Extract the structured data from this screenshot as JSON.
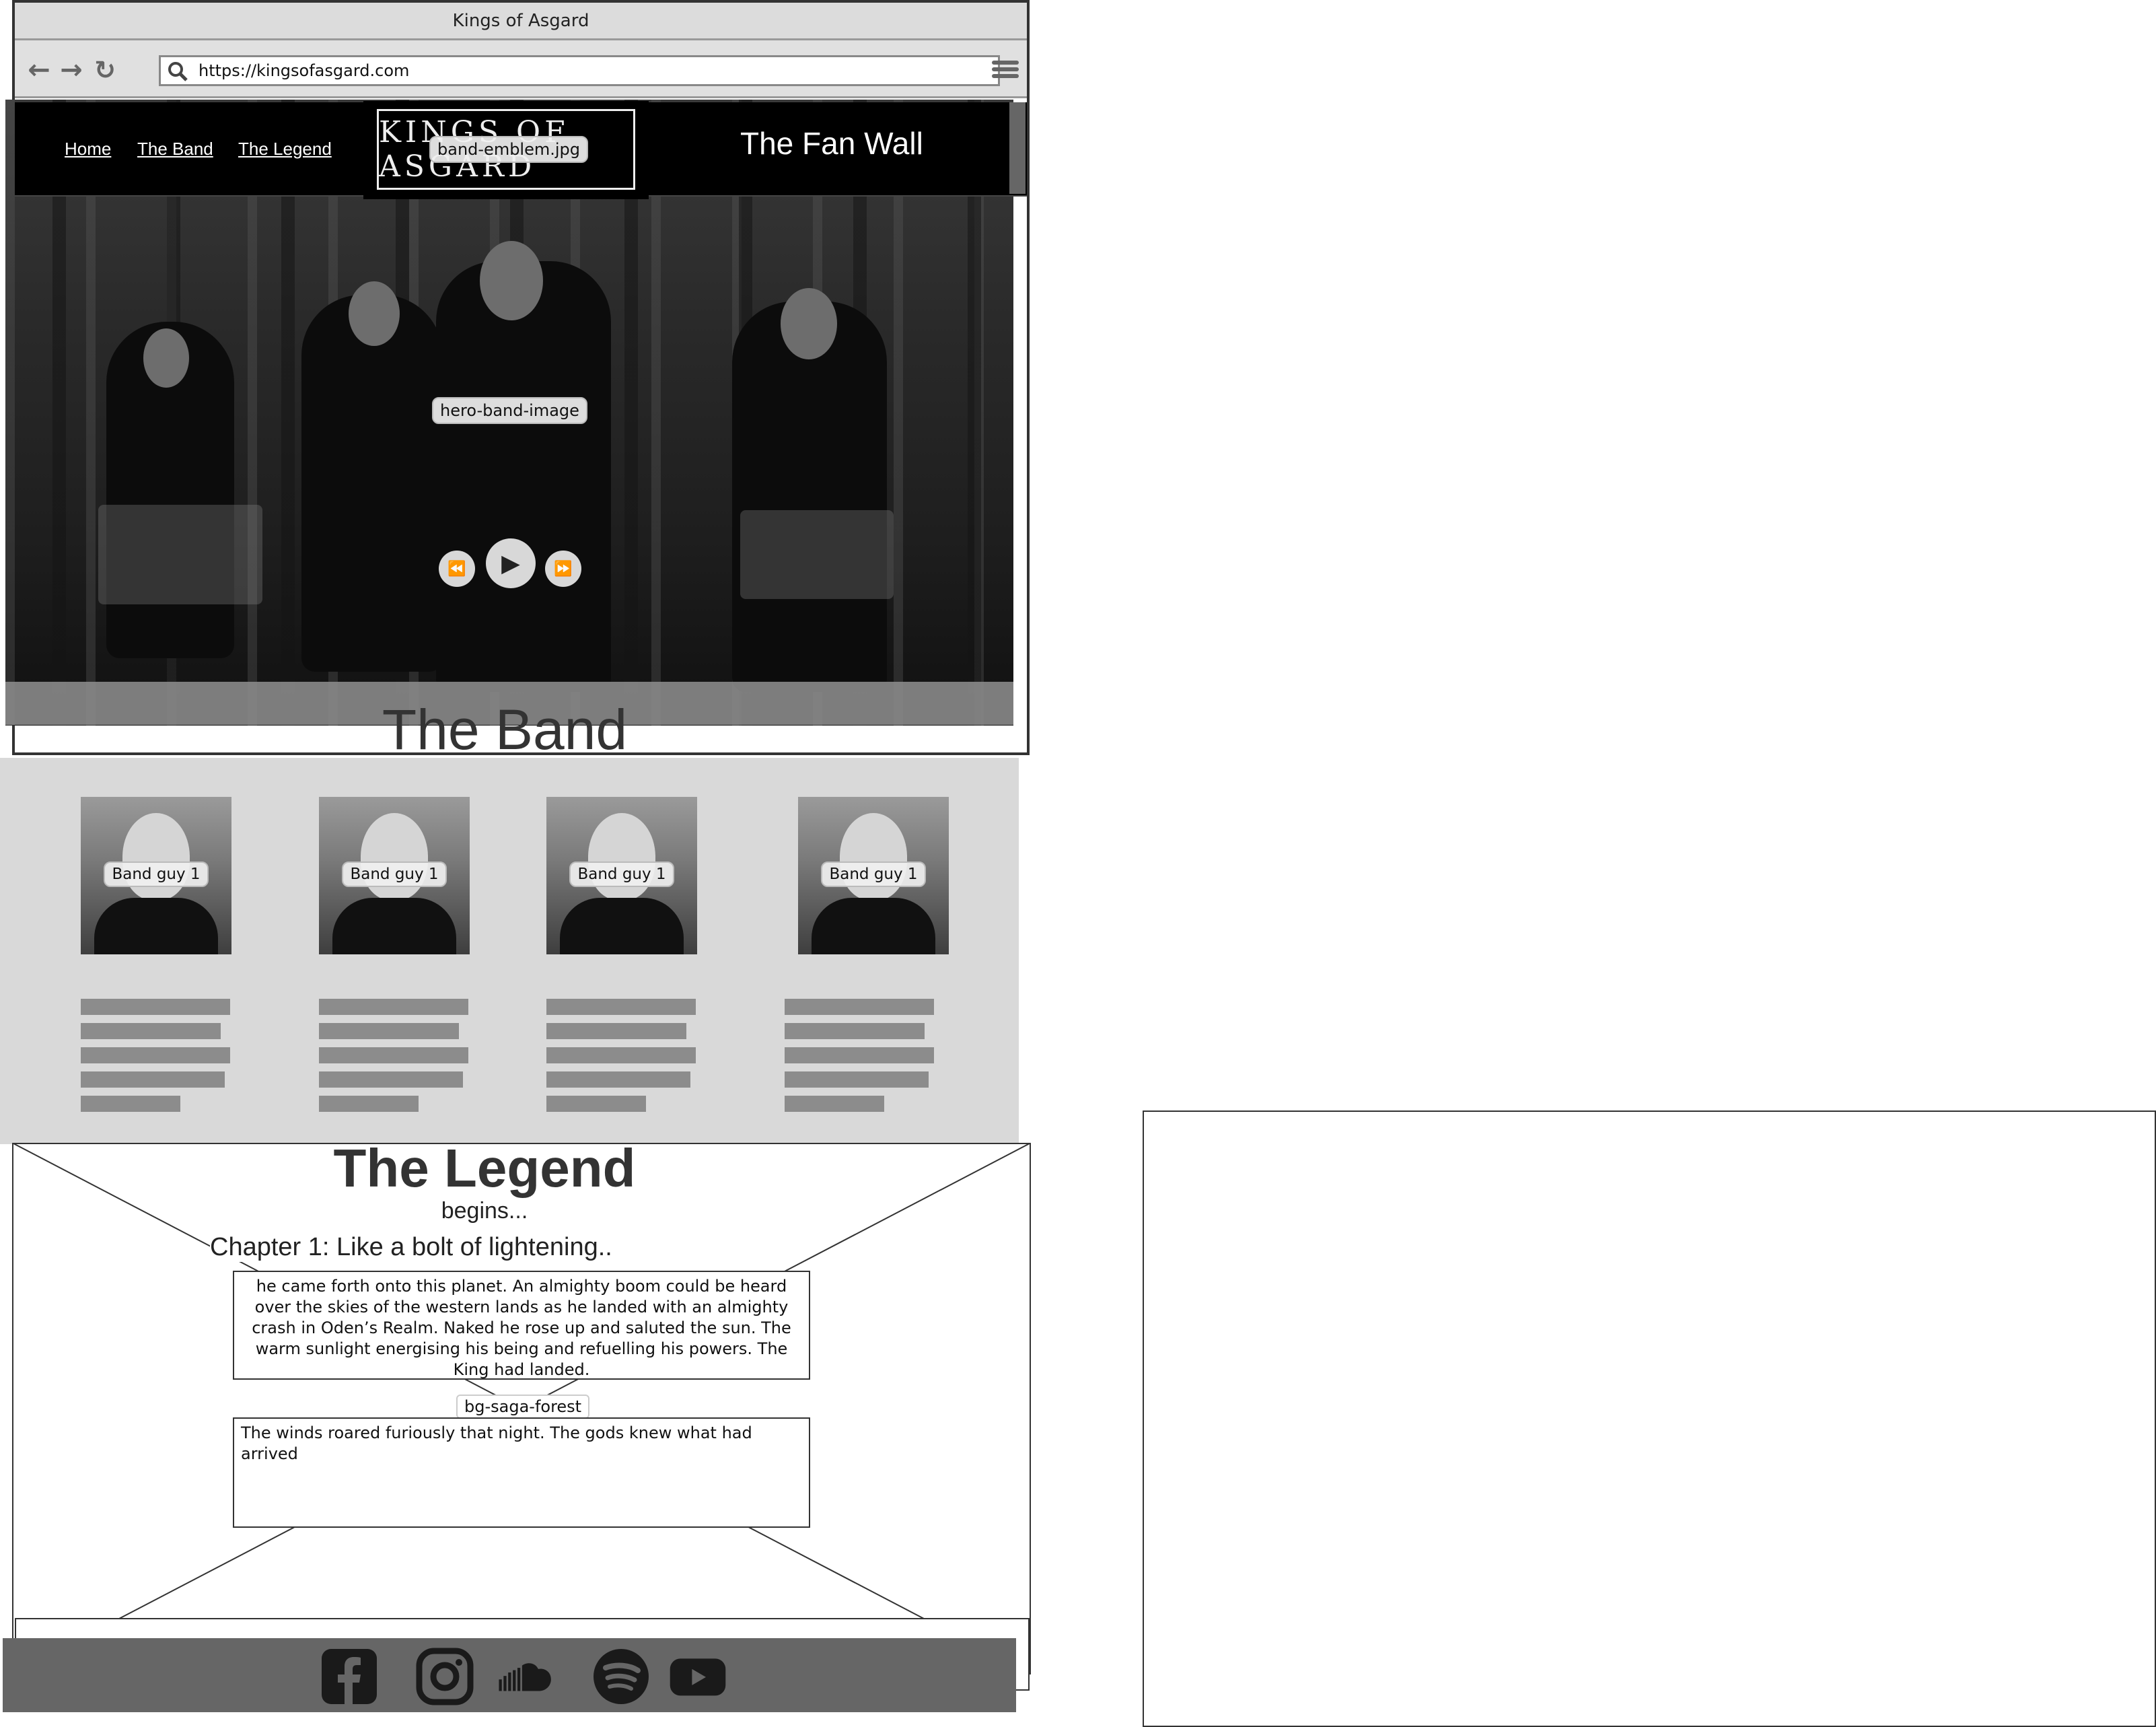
{
  "browser": {
    "title": "Kings of Asgard",
    "url": "https://kingsofasgard.com"
  },
  "nav": {
    "links": [
      "Home",
      "The Band",
      "The Legend"
    ],
    "fan_wall": "The Fan Wall",
    "emblem_label": "band-emblem.jpg",
    "emblem_lettering": "KINGS OF ASGARD"
  },
  "hero": {
    "image_label": "hero-band-image",
    "player": {
      "rewind": "⏪",
      "play": "▶",
      "forward": "⏩"
    }
  },
  "band": {
    "heading": "The Band",
    "members": [
      {
        "label": "Band guy 1"
      },
      {
        "label": "Band guy 1"
      },
      {
        "label": "Band guy 1"
      },
      {
        "label": "Band guy 1"
      }
    ]
  },
  "legend": {
    "title": "The Legend",
    "subtitle": "begins...",
    "chapter": "Chapter 1: Like a bolt of lightening..",
    "paragraph1": "he came forth onto this planet. An almighty boom could be heard over the skies of the western lands as he landed with an almighty crash in Oden’s Realm. Naked he rose up and saluted the sun. The warm sunlight energising his being and refuelling his powers. The King had landed.",
    "bg_label": "bg-saga-forest",
    "paragraph2": "The winds roared furiously that night. The gods knew what had arrived"
  },
  "footer": {
    "icons": [
      "facebook-icon",
      "instagram-icon",
      "soundcloud-icon",
      "spotify-icon",
      "youtube-icon"
    ],
    "colors": {
      "bar": "#666666",
      "icon": "#1a1a1a"
    }
  }
}
